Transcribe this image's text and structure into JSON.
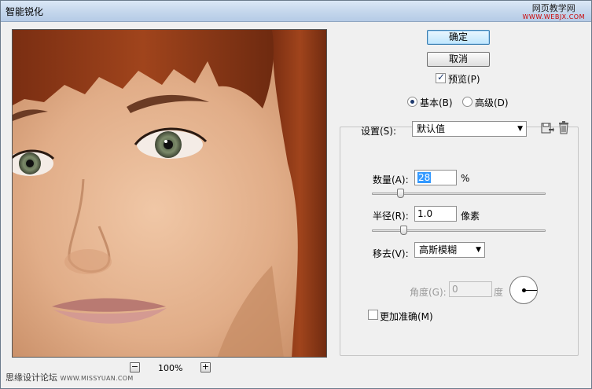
{
  "window": {
    "title": "智能锐化"
  },
  "watermark_top": {
    "line1": "网页教学网",
    "line2": "WWW.WEBJX.COM"
  },
  "watermark_bottom": {
    "text": "思缘设计论坛",
    "url": "WWW.MISSYUAN.COM"
  },
  "preview": {
    "zoom_out": "−",
    "zoom_in": "+",
    "zoom_value": "100%"
  },
  "buttons": {
    "ok": "确定",
    "cancel": "取消"
  },
  "preview_toggle": {
    "label": "预览(P)",
    "checked": true
  },
  "mode": {
    "basic_label": "基本(B)",
    "advanced_label": "高级(D)",
    "selected": "basic"
  },
  "settings": {
    "label": "设置(S):",
    "value": "默认值"
  },
  "amount": {
    "label": "数量(A):",
    "value_selected": "28",
    "unit": "%",
    "slider_fraction": 0.15
  },
  "radius": {
    "label": "半径(R):",
    "value": "1.0",
    "unit": "像素",
    "slider_fraction": 0.17
  },
  "remove": {
    "label": "移去(V):",
    "value": "高斯模糊"
  },
  "angle": {
    "label": "角度(G):",
    "value": "0",
    "unit": "度"
  },
  "more_accurate": {
    "label": "更加准确(M)",
    "checked": false
  },
  "icons": {
    "save": "save-settings-icon",
    "delete": "delete-settings-icon"
  }
}
